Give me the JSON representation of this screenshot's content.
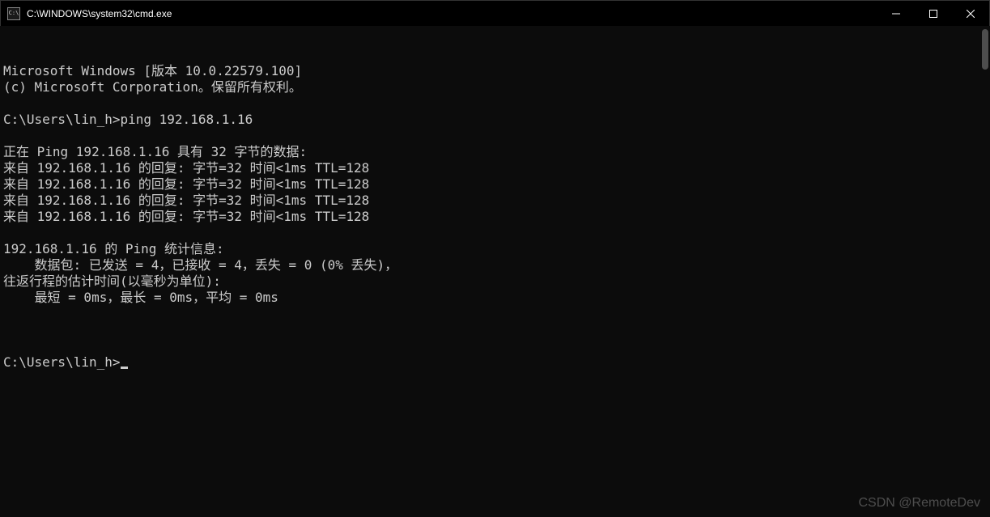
{
  "window": {
    "icon_text": "C:\\",
    "title": "C:\\WINDOWS\\system32\\cmd.exe"
  },
  "terminal": {
    "lines": [
      "Microsoft Windows [版本 10.0.22579.100]",
      "(c) Microsoft Corporation。保留所有权利。",
      "",
      "C:\\Users\\lin_h>ping 192.168.1.16",
      "",
      "正在 Ping 192.168.1.16 具有 32 字节的数据:",
      "来自 192.168.1.16 的回复: 字节=32 时间<1ms TTL=128",
      "来自 192.168.1.16 的回复: 字节=32 时间<1ms TTL=128",
      "来自 192.168.1.16 的回复: 字节=32 时间<1ms TTL=128",
      "来自 192.168.1.16 的回复: 字节=32 时间<1ms TTL=128",
      "",
      "192.168.1.16 的 Ping 统计信息:",
      "    数据包: 已发送 = 4，已接收 = 4，丢失 = 0 (0% 丢失)，",
      "往返行程的估计时间(以毫秒为单位):",
      "    最短 = 0ms，最长 = 0ms，平均 = 0ms",
      ""
    ],
    "prompt": "C:\\Users\\lin_h>"
  },
  "watermark": "CSDN @RemoteDev"
}
